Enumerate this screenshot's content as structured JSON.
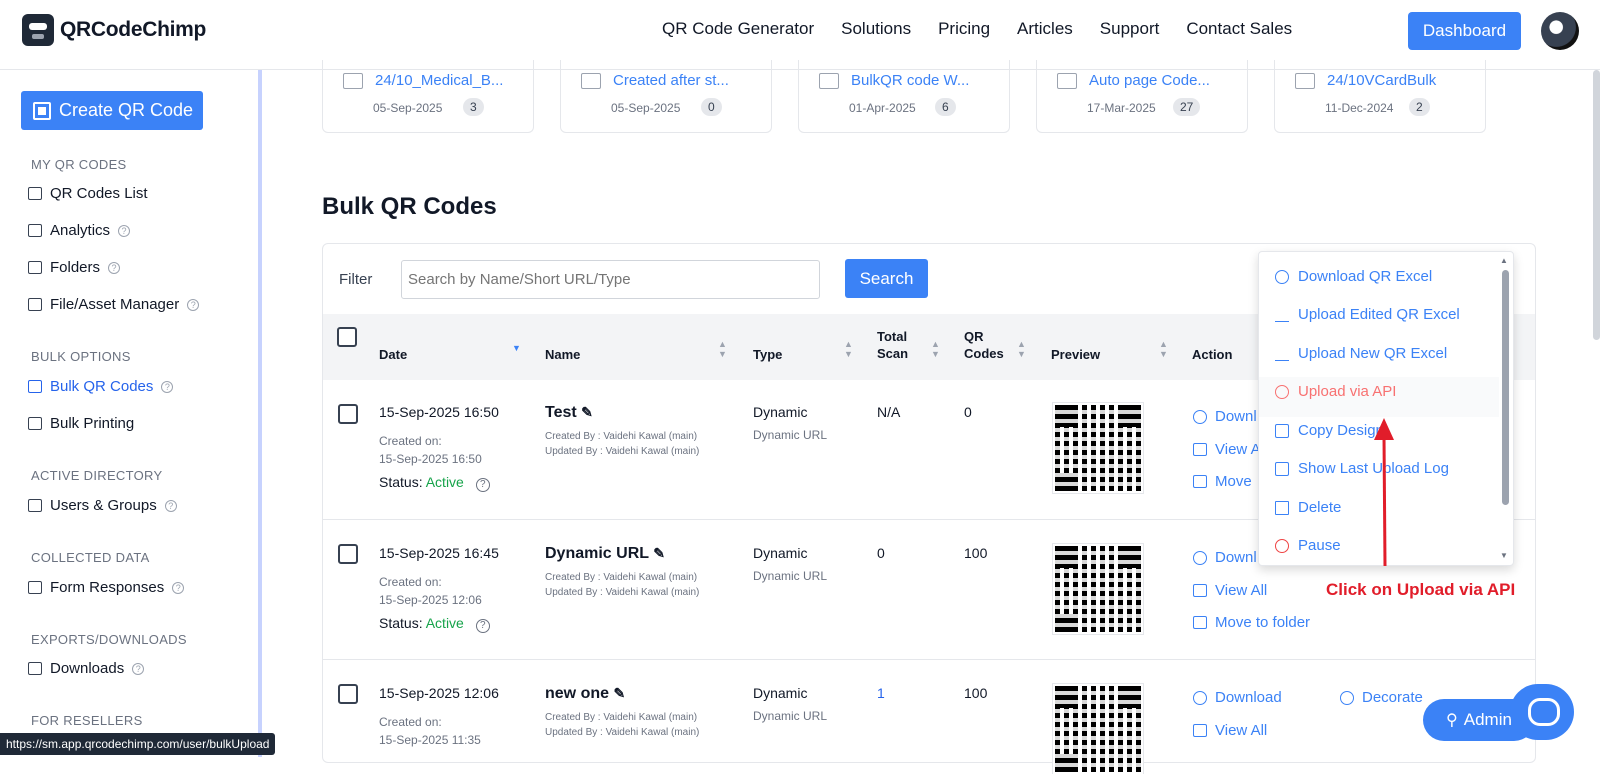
{
  "brand": {
    "name": "QRCodeChimp"
  },
  "nav": {
    "items": [
      "QR Code Generator",
      "Solutions",
      "Pricing",
      "Articles",
      "Support",
      "Contact Sales"
    ],
    "dashboard_label": "Dashboard"
  },
  "sidebar": {
    "create_label": "Create QR Code",
    "sections": {
      "my_qr": "MY QR CODES",
      "bulk": "BULK OPTIONS",
      "active_dir": "ACTIVE DIRECTORY",
      "collected": "COLLECTED DATA",
      "exports": "EXPORTS/DOWNLOADS",
      "resellers": "FOR RESELLERS"
    },
    "items": {
      "qr_list": "QR Codes List",
      "analytics": "Analytics",
      "folders": "Folders",
      "file_manager": "File/Asset Manager",
      "bulk_qr": "Bulk QR Codes",
      "bulk_printing": "Bulk Printing",
      "users_groups": "Users & Groups",
      "form_responses": "Form Responses",
      "downloads": "Downloads"
    },
    "help_glyph": "?"
  },
  "status_url": "https://sm.app.qrcodechimp.com/user/bulkUpload",
  "folders": [
    {
      "name": "24/10_Medical_B...",
      "date": "05-Sep-2025",
      "count": "3"
    },
    {
      "name": "Created after st...",
      "date": "05-Sep-2025",
      "count": "0"
    },
    {
      "name": "BulkQR code W...",
      "date": "01-Apr-2025",
      "count": "6"
    },
    {
      "name": "Auto page Code...",
      "date": "17-Mar-2025",
      "count": "27"
    },
    {
      "name": "24/10VCardBulk",
      "date": "11-Dec-2024",
      "count": "2"
    }
  ],
  "page_title": "Bulk QR Codes",
  "filter": {
    "label": "Filter",
    "placeholder": "Search by Name/Short URL/Type",
    "search_label": "Search"
  },
  "columns": {
    "date": "Date",
    "name": "Name",
    "type": "Type",
    "total_scan_1": "Total",
    "total_scan_2": "Scan",
    "qr_codes_1": "QR",
    "qr_codes_2": "Codes",
    "preview": "Preview",
    "action": "Action"
  },
  "rows": [
    {
      "date": "15-Sep-2025 16:50",
      "created_label": "Created on:",
      "created_on": "15-Sep-2025 16:50",
      "status_label": "Status:",
      "status": "Active",
      "name": "Test",
      "created_by": "Created By : Vaidehi Kawal (main)",
      "updated_by": "Updated By : Vaidehi Kawal (main)",
      "type": "Dynamic",
      "subtype": "Dynamic URL",
      "total_scan": "N/A",
      "qr_codes": "0",
      "actions": [
        "Downl",
        "View A",
        "Move"
      ]
    },
    {
      "date": "15-Sep-2025 16:45",
      "created_label": "Created on:",
      "created_on": "15-Sep-2025 12:06",
      "status_label": "Status:",
      "status": "Active",
      "name": "Dynamic URL",
      "created_by": "Created By : Vaidehi Kawal (main)",
      "updated_by": "Updated By : Vaidehi Kawal (main)",
      "type": "Dynamic",
      "subtype": "Dynamic URL",
      "total_scan": "0",
      "qr_codes": "100",
      "actions": [
        "Downl",
        "View All",
        "Move to folder"
      ]
    },
    {
      "date": "15-Sep-2025 12:06",
      "created_label": "Created on:",
      "created_on": "15-Sep-2025 11:35",
      "name": "new one",
      "created_by": "Created By : Vaidehi Kawal (main)",
      "updated_by": "Updated By : Vaidehi Kawal (main)",
      "type": "Dynamic",
      "subtype": "Dynamic URL",
      "total_scan": "1",
      "qr_codes": "100",
      "actions": [
        "Download",
        "View All"
      ],
      "decorate": "Decorate"
    }
  ],
  "action_menu": {
    "items": [
      "Download QR Excel",
      "Upload Edited QR Excel",
      "Upload New QR Excel",
      "Upload via API",
      "Copy Design",
      "Show Last Upload Log",
      "Delete",
      "Pause"
    ],
    "highlighted": "Upload via API"
  },
  "annotation": "Click on Upload via API",
  "admin_label": "Admin",
  "colors": {
    "accent": "#3b82f6",
    "active_status": "#16a34a",
    "annotation": "#e11d2a",
    "highlight": "#f87171"
  }
}
